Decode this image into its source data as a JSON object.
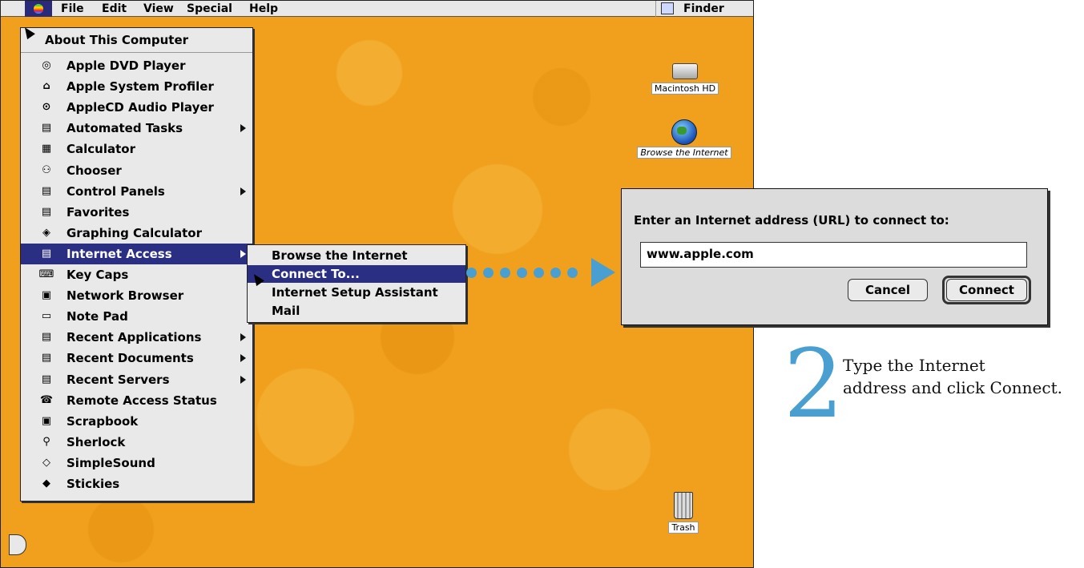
{
  "menubar": {
    "apple_icon": "apple-logo-icon",
    "items": [
      "File",
      "Edit",
      "View",
      "Special",
      "Help"
    ],
    "finder_label": "Finder"
  },
  "apple_menu": {
    "about": "About This Computer",
    "items": [
      {
        "label": "Apple DVD Player",
        "icon": "dvd-icon"
      },
      {
        "label": "Apple System Profiler",
        "icon": "profiler-icon"
      },
      {
        "label": "AppleCD Audio Player",
        "icon": "cd-player-icon"
      },
      {
        "label": "Automated Tasks",
        "icon": "folder-icon",
        "submenu": true
      },
      {
        "label": "Calculator",
        "icon": "calculator-icon"
      },
      {
        "label": "Chooser",
        "icon": "chooser-icon"
      },
      {
        "label": "Control Panels",
        "icon": "folder-icon",
        "submenu": true
      },
      {
        "label": "Favorites",
        "icon": "folder-icon"
      },
      {
        "label": "Graphing Calculator",
        "icon": "graphing-icon"
      },
      {
        "label": "Internet Access",
        "icon": "folder-icon",
        "submenu": true,
        "highlighted": true
      },
      {
        "label": "Key Caps",
        "icon": "keycaps-icon"
      },
      {
        "label": "Network Browser",
        "icon": "network-icon"
      },
      {
        "label": "Note Pad",
        "icon": "notepad-icon"
      },
      {
        "label": "Recent Applications",
        "icon": "folder-icon",
        "submenu": true
      },
      {
        "label": "Recent Documents",
        "icon": "folder-icon",
        "submenu": true
      },
      {
        "label": "Recent Servers",
        "icon": "folder-icon",
        "submenu": true
      },
      {
        "label": "Remote Access Status",
        "icon": "remote-access-icon"
      },
      {
        "label": "Scrapbook",
        "icon": "scrapbook-icon"
      },
      {
        "label": "Sherlock",
        "icon": "sherlock-icon"
      },
      {
        "label": "SimpleSound",
        "icon": "sound-icon"
      },
      {
        "label": "Stickies",
        "icon": "stickies-icon"
      }
    ]
  },
  "internet_submenu": {
    "items": [
      {
        "label": "Browse the Internet"
      },
      {
        "label": "Connect To...",
        "highlighted": true
      },
      {
        "label": "Internet Setup Assistant"
      },
      {
        "label": "Mail"
      }
    ]
  },
  "desktop_icons": {
    "hd": "Macintosh HD",
    "browse": "Browse the Internet",
    "trash": "Trash"
  },
  "dialog": {
    "prompt": "Enter an Internet address (URL) to connect to:",
    "url_value": "www.apple.com",
    "cancel": "Cancel",
    "connect": "Connect"
  },
  "instruction": {
    "step": "2",
    "line1": "Type the Internet",
    "line2": "address and click Connect."
  },
  "colors": {
    "desktop": "#f0a01c",
    "highlight": "#2b2f83",
    "accent": "#4a9fd1"
  }
}
